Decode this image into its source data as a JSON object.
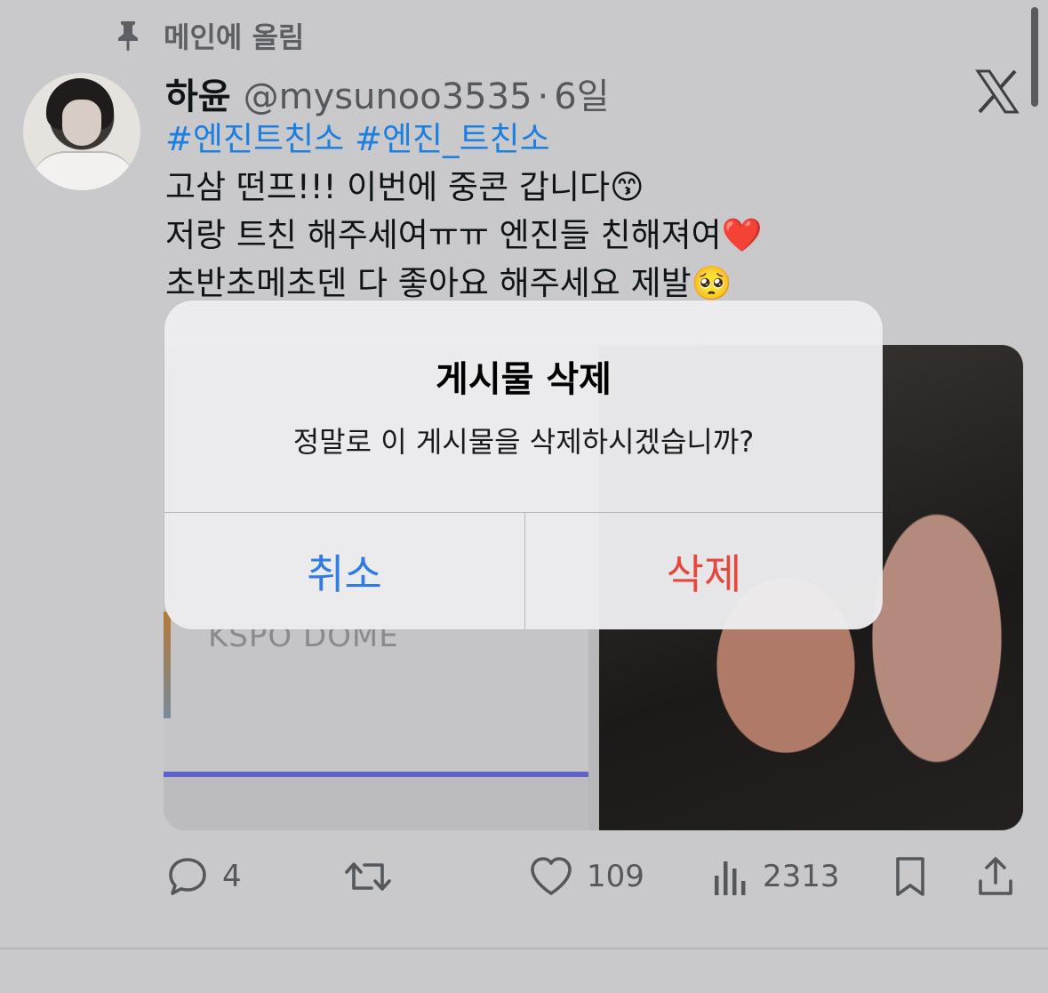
{
  "pinned": {
    "label": "메인에 올림",
    "icon": "pin-icon"
  },
  "tweet": {
    "name": "하윤",
    "handle": "@mysunoo3535",
    "separator": "·",
    "time": "6일",
    "hashtags": [
      "#엔진트친소",
      "#엔진_트친소"
    ],
    "lines": [
      "고삼 떤프!!! 이번에 중콘 갑니다😙",
      "저랑 트친 해주세여ㅠㅠ 엔진들 친해져여❤️",
      "초반초메초덴 다 좋아요 해주세요 제발🥺"
    ],
    "media": {
      "left_text": "KSPO DOME"
    }
  },
  "actions": {
    "replies": "4",
    "likes": "109",
    "views": "2313"
  },
  "dialog": {
    "title": "게시물 삭제",
    "message": "정말로 이 게시물을 삭제하시겠습니까?",
    "cancel_label": "취소",
    "delete_label": "삭제"
  },
  "colors": {
    "background": "#c9c9cb",
    "link": "#1d7fe0",
    "cancel": "#2e7ce4",
    "destructive": "#e5473c"
  }
}
